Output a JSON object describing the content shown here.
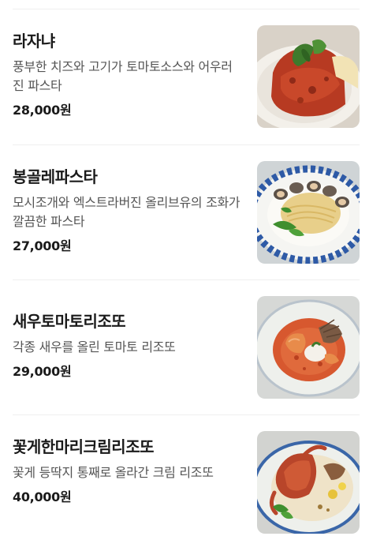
{
  "menu": {
    "items": [
      {
        "name": "라자냐",
        "description": "풍부한 치즈와 고기가 토마토소스와 어우러진 파스타",
        "price": "28,000원",
        "image": "lasagna-photo"
      },
      {
        "name": "봉골레파스타",
        "description": "모시조개와 엑스트라버진 올리브유의 조화가 깔끔한 파스타",
        "price": "27,000원",
        "image": "vongole-pasta-photo"
      },
      {
        "name": "새우토마토리조또",
        "description": "각종 새우를 올린 토마토 리조또",
        "price": "29,000원",
        "image": "shrimp-tomato-risotto-photo"
      },
      {
        "name": "꽃게한마리크림리조또",
        "description": "꽃게 등딱지 통째로 올라간 크림 리조또",
        "price": "40,000원",
        "image": "crab-cream-risotto-photo"
      }
    ]
  }
}
